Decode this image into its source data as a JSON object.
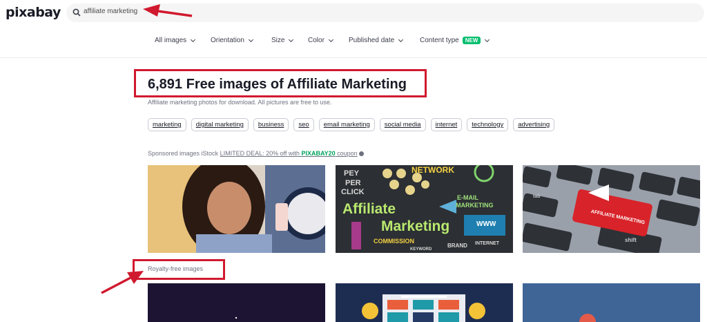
{
  "header": {
    "logo": "pixabay",
    "search_value": "affiliate marketing"
  },
  "filters": [
    {
      "label": "All images"
    },
    {
      "label": "Orientation"
    },
    {
      "label": "Size"
    },
    {
      "label": "Color"
    },
    {
      "label": "Published date"
    },
    {
      "label": "Content type",
      "badge": "NEW"
    }
  ],
  "results": {
    "title": "6,891 Free images of Affiliate Marketing",
    "subtitle": "Affiliate marketing photos for download. All pictures are free to use."
  },
  "tags": [
    "marketing",
    "digital marketing",
    "business",
    "seo",
    "email marketing",
    "social media",
    "internet",
    "technology",
    "advertising"
  ],
  "sponsored": {
    "prefix": "Sponsored images iStock ",
    "deal": "LIMITED DEAL: 20% off with ",
    "coupon": "PIXABAY20",
    "suffix": " coupon"
  },
  "image_texts": {
    "network": "NETWORK",
    "pey": "PEY",
    "per": "PER",
    "click": "CLICK",
    "affiliate": "Affiliate",
    "marketing": "Marketing",
    "email": "E-MAIL",
    "email_marketing": "MARKETING",
    "www": "WWW",
    "commission": "COMMISSION",
    "brand": "BRAND",
    "internet": "INTERNET",
    "keyword": "KEYWORD",
    "key_label": "AFFILIATE MARKETING",
    "shift": "shift",
    "tab": "tab"
  },
  "royalty_label": "Royalty-free images",
  "colors": {
    "annotation": "#d0192e",
    "new_badge": "#02be6e",
    "coupon": "#02a15c"
  }
}
